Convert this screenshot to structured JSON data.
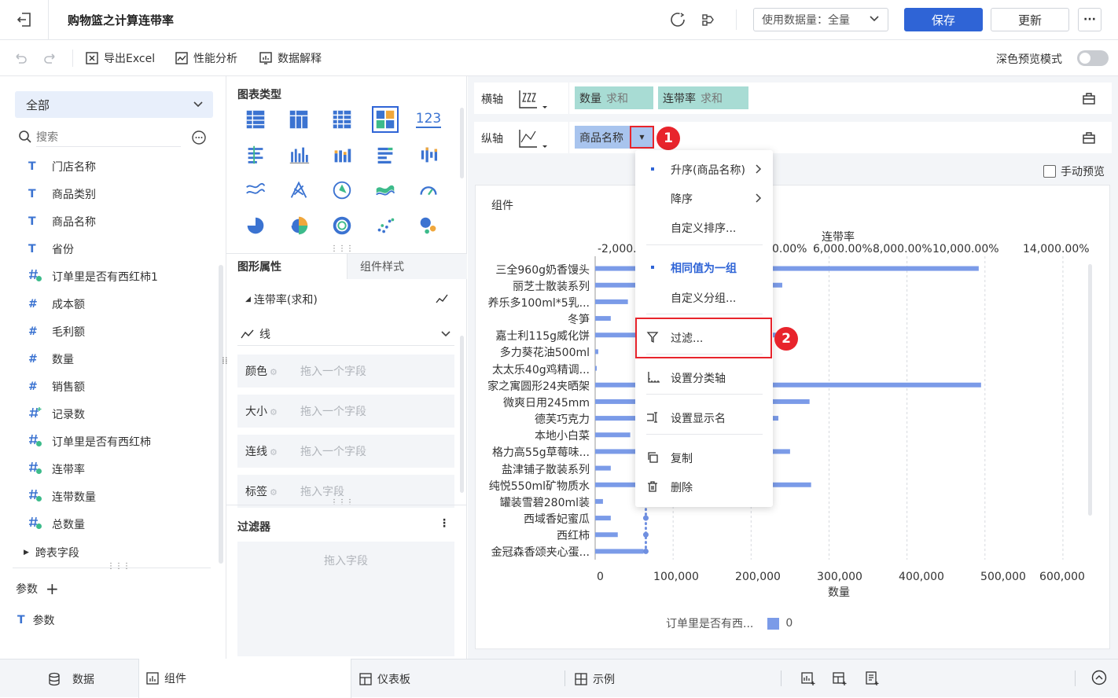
{
  "header": {
    "title": "购物篮之计算连带率",
    "data_usage_label": "使用数据量：全量",
    "save_label": "保存",
    "update_label": "更新",
    "more_label": "···"
  },
  "toolbar": {
    "export_excel": "导出Excel",
    "perf_analysis": "性能分析",
    "data_explain": "数据解释",
    "dark_preview": "深色预览模式"
  },
  "left": {
    "scope": "全部",
    "search_placeholder": "搜索",
    "fields": [
      {
        "type": "text",
        "label": "门店名称"
      },
      {
        "type": "text",
        "label": "商品类别"
      },
      {
        "type": "text",
        "label": "商品名称"
      },
      {
        "type": "text",
        "label": "省份"
      },
      {
        "type": "calc",
        "label": "订单里是否有西红柿1"
      },
      {
        "type": "num",
        "label": "成本额"
      },
      {
        "type": "num",
        "label": "毛利额"
      },
      {
        "type": "num",
        "label": "数量"
      },
      {
        "type": "num",
        "label": "销售额"
      },
      {
        "type": "count",
        "label": "记录数"
      },
      {
        "type": "calc",
        "label": "订单里是否有西红柿"
      },
      {
        "type": "calc",
        "label": "连带率"
      },
      {
        "type": "calc",
        "label": "连带数量"
      },
      {
        "type": "calc",
        "label": "总数量"
      }
    ],
    "cross_table": "跨表字段",
    "params_header": "参数",
    "params_item": "参数"
  },
  "middle": {
    "chart_type_title": "图表类型",
    "chart_type_text_icon": "123",
    "tab_graph_props": "图形属性",
    "tab_component_style": "组件样式",
    "measure_label": "连带率(求和)",
    "mark_type": "线",
    "props": [
      {
        "label": "颜色",
        "placeholder": "拖入一个字段"
      },
      {
        "label": "大小",
        "placeholder": "拖入一个字段"
      },
      {
        "label": "连线",
        "placeholder": "拖入一个字段"
      },
      {
        "label": "标签",
        "placeholder": "拖入字段"
      }
    ],
    "filter_title": "过滤器",
    "filter_placeholder": "拖入字段"
  },
  "axes": {
    "x_label": "横轴",
    "y_label": "纵轴",
    "x_fields": [
      {
        "name": "数量",
        "agg": "求和"
      },
      {
        "name": "连带率",
        "agg": "求和"
      }
    ],
    "y_fields": [
      {
        "name": "商品名称"
      }
    ],
    "manual_preview": "手动预览",
    "badge1": "1",
    "badge2": "2"
  },
  "dropdown": {
    "items": [
      {
        "label": "升序(商品名称)",
        "bullet": true,
        "arrow": true
      },
      {
        "label": "降序",
        "bullet": false,
        "arrow": true
      },
      {
        "label": "自定义排序...",
        "bullet": false,
        "arrow": false
      },
      {
        "label": "相同值为一组",
        "bullet": true,
        "arrow": false,
        "active": true
      },
      {
        "label": "自定义分组...",
        "bullet": false,
        "arrow": false
      },
      {
        "label": "过滤...",
        "icon": "filter-icon"
      },
      {
        "label": "设置分类轴",
        "icon": "axis-icon"
      },
      {
        "label": "设置显示名",
        "icon": "rename-icon"
      },
      {
        "label": "复制",
        "icon": "copy-icon"
      },
      {
        "label": "删除",
        "icon": "delete-icon"
      }
    ]
  },
  "chart_data": {
    "type": "bar",
    "component_title": "组件",
    "top_axis_title": "连带率",
    "top_axis_ticks": [
      "-2,000.0",
      "0.00%",
      "6,000.00%",
      "8,000.00%",
      "10,000.00%",
      "14,000.00%"
    ],
    "bottom_axis_title": "数量",
    "bottom_axis_ticks": [
      "0",
      "100,000",
      "200,000",
      "300,000",
      "400,000",
      "500,000",
      "600,000"
    ],
    "xlim": [
      0,
      600000
    ],
    "categories": [
      "三全960g奶香馒头",
      "丽芝士散装系列",
      "养乐多100ml*5乳...",
      "冬笋",
      "嘉士利115g威化饼",
      "多力葵花油500ml",
      "太太乐40g鸡精调...",
      "家之寓圆形24夹晒架",
      "微爽日用245mm",
      "德芙巧克力",
      "本地小白菜",
      "格力高55g草莓味...",
      "盐津铺子散装系列",
      "纯悦550ml矿物质水",
      "罐装雪碧280ml装",
      "西域香妃蜜瓜",
      "西红柿",
      "金冠森香颂夹心蛋..."
    ],
    "series": [
      {
        "name": "0",
        "values": [
          492000,
          240000,
          42000,
          20000,
          240000,
          4000,
          2000,
          495000,
          275000,
          235000,
          45000,
          250000,
          20000,
          277000,
          10000,
          20000,
          29000,
          62000
        ]
      }
    ],
    "legend_title": "订单里是否有西...",
    "legend_position": "bottom",
    "line_values": [
      65000,
      65000,
      65000,
      65000,
      65000,
      65000,
      65000,
      65000,
      65000,
      65000,
      65000,
      65000,
      65000,
      65000,
      65000,
      65000,
      65000,
      65000
    ],
    "bar_color": "#7b9be8",
    "line_color": "#6f8fe0"
  },
  "bottom": {
    "tabs": [
      "数据",
      "组件",
      "仪表板",
      "示例"
    ]
  },
  "colors": {
    "primary": "#2f64d6",
    "badge": "#e8242c",
    "pill": "#a8dcd4",
    "pill_y": "#a8c4ee"
  }
}
